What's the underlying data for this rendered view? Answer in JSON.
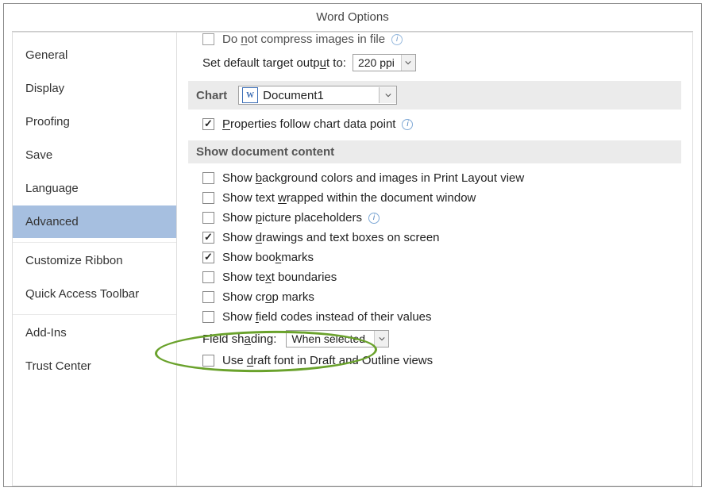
{
  "window_title": "Word Options",
  "sidebar": {
    "items": [
      {
        "label": "General"
      },
      {
        "label": "Display"
      },
      {
        "label": "Proofing"
      },
      {
        "label": "Save"
      },
      {
        "label": "Language"
      },
      {
        "label": "Advanced"
      },
      {
        "label": "Customize Ribbon"
      },
      {
        "label": "Quick Access Toolbar"
      },
      {
        "label": "Add-Ins"
      },
      {
        "label": "Trust Center"
      }
    ],
    "selected_index": 5
  },
  "content": {
    "compress_prefix": "Do ",
    "compress_u": "n",
    "compress_suffix": "ot compress images in file",
    "output_label_prefix": "Set default target outp",
    "output_label_u": "u",
    "output_label_suffix": "t to:",
    "output_value": "220 ppi",
    "chart_label": "Chart",
    "chart_doc": "Document1",
    "prop_prefix": "",
    "prop_u": "P",
    "prop_suffix": "roperties follow chart data point",
    "section2": "Show document content",
    "cb_bg_prefix": "Show ",
    "cb_bg_u": "b",
    "cb_bg_suffix": "ackground colors and images in Print Layout view",
    "cb_wrap_prefix": "Show text ",
    "cb_wrap_u": "w",
    "cb_wrap_suffix": "rapped within the document window",
    "cb_pic_prefix": "Show ",
    "cb_pic_u": "p",
    "cb_pic_suffix": "icture placeholders",
    "cb_draw_prefix": "Show ",
    "cb_draw_u": "d",
    "cb_draw_suffix": "rawings and text boxes on screen",
    "cb_bm_prefix": "Show boo",
    "cb_bm_u": "k",
    "cb_bm_suffix": "marks",
    "cb_tb_prefix": "Show te",
    "cb_tb_u": "x",
    "cb_tb_suffix": "t boundaries",
    "cb_crop_prefix": "Show cr",
    "cb_crop_u": "o",
    "cb_crop_suffix": "p marks",
    "cb_field_prefix": "Show ",
    "cb_field_u": "f",
    "cb_field_suffix": "ield codes instead of their values",
    "shading_label_prefix": "Field sh",
    "shading_label_u": "a",
    "shading_label_suffix": "ding:",
    "shading_value": "When selected",
    "cb_draft_prefix": "Use ",
    "cb_draft_u": "d",
    "cb_draft_suffix": "raft font in Draft and Outline views"
  }
}
